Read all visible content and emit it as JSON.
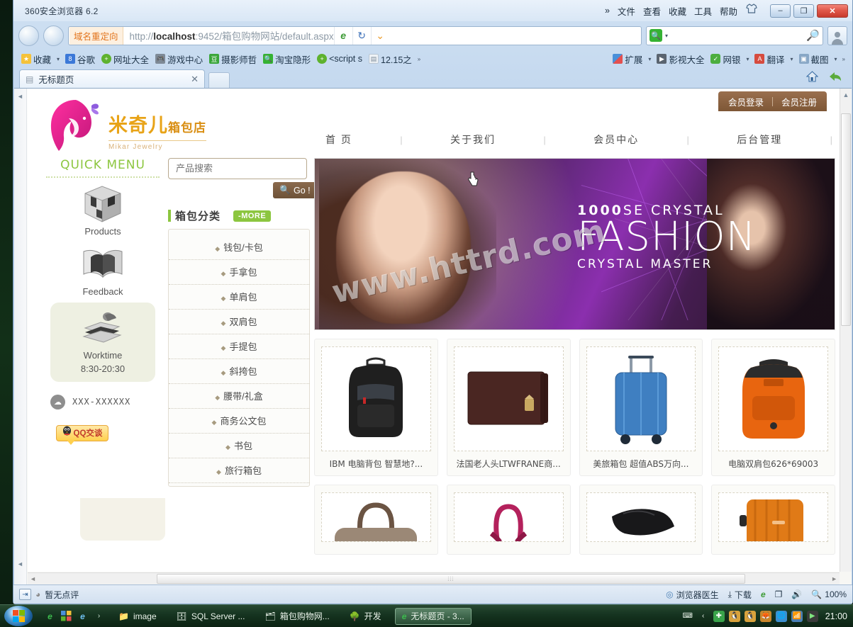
{
  "browser": {
    "window_title": "360安全浏览器 6.2",
    "menu": [
      "文件",
      "查看",
      "收藏",
      "工具",
      "帮助"
    ],
    "overflow_icon": "chevron-double-right-icon",
    "skin_icon": "shirt-icon",
    "window_buttons": {
      "minimize": "–",
      "maximize": "❐",
      "close": "✕"
    },
    "address": {
      "redirect_badge": "域名重定向",
      "url_prefix": "http://",
      "url_host": "localhost",
      "url_rest": ":9452/箱包购物网站/default.aspx",
      "icons": [
        "ie-engine-icon",
        "sync-icon",
        "chevron-down-icon"
      ]
    },
    "search": {
      "placeholder": "",
      "engine_icon": "search-icon",
      "go_icon": "magnifier-icon"
    },
    "account_icon": "user-avatar-icon",
    "bookmarks": [
      {
        "label": "收藏",
        "icon": "star-folder-icon",
        "caret": true
      },
      {
        "label": "谷歌",
        "icon": "google-icon",
        "caret": false
      },
      {
        "label": "网址大全",
        "icon": "plus-circle-icon",
        "caret": false
      },
      {
        "label": "游戏中心",
        "icon": "gamepad-icon",
        "caret": false
      },
      {
        "label": "摄影师哲",
        "icon": "douban-icon",
        "caret": false
      },
      {
        "label": "淘宝隐形",
        "icon": "search-square-icon",
        "caret": false
      },
      {
        "label": "<script s",
        "icon": "plus-circle-icon",
        "caret": false
      },
      {
        "label": "12.15之",
        "icon": "page-icon",
        "caret": false
      },
      {
        "label": "»",
        "icon": "chevron-double-right-icon",
        "caret": false
      }
    ],
    "toolbar_right": [
      {
        "label": "扩展",
        "icon": "extensions-icon",
        "caret": true
      },
      {
        "label": "影视大全",
        "icon": "video-icon",
        "caret": false
      },
      {
        "label": "网银",
        "icon": "shield-icon",
        "caret": true
      },
      {
        "label": "翻译",
        "icon": "translate-icon",
        "caret": true
      },
      {
        "label": "截图",
        "icon": "screenshot-icon",
        "caret": true
      },
      {
        "label": "»",
        "icon": "chevron-double-right-icon",
        "caret": false
      }
    ],
    "tab": {
      "label": "无标题页",
      "favicon": "page-icon",
      "close": "✕"
    },
    "tab_right_icons": [
      "home-icon",
      "back-arrow-icon"
    ]
  },
  "statusbar": {
    "expand_icon": "panel-toggle-icon",
    "rating_text": "暂无点评",
    "items": [
      {
        "label": "浏览器医生",
        "icon": "doctor-icon"
      },
      {
        "label": "下载",
        "icon": "download-icon"
      },
      {
        "label": "",
        "icon": "ie-engine-icon"
      },
      {
        "label": "",
        "icon": "windows-stack-icon"
      },
      {
        "label": "",
        "icon": "speaker-icon"
      },
      {
        "label": "100%",
        "icon": "magnifier-icon"
      }
    ]
  },
  "taskbar": {
    "start_icon": "windows-start-icon",
    "quick_launch": [
      "360-browser-icon",
      "apps-icon",
      "ie-icon",
      "chevron-right-icon"
    ],
    "items": [
      {
        "label": "image",
        "icon": "folder-icon",
        "active": false
      },
      {
        "label": "SQL Server ...",
        "icon": "sql-server-icon",
        "active": false
      },
      {
        "label": "箱包购物网...",
        "icon": "vs-project-icon",
        "active": false
      },
      {
        "label": "开发",
        "icon": "tree-icon",
        "active": false
      },
      {
        "label": "无标题页 - 3...",
        "icon": "ie-engine-icon",
        "active": true
      }
    ],
    "tray_icons": [
      "keyboard-icon",
      "chevron-left-icon",
      "antivirus-icon",
      "qq-icon",
      "qq-icon-2",
      "fox-icon",
      "globe-icon",
      "network-icon",
      "media-icon"
    ],
    "clock": "21:00"
  },
  "site": {
    "logo": {
      "title_cn": "米奇儿",
      "title_suffix": "箱包店",
      "subtitle_en": "Mikar Jewelry"
    },
    "auth": {
      "login": "会员登录",
      "register": "会员注册"
    },
    "nav": [
      "首 页",
      "关于我们",
      "会员中心",
      "后台管理"
    ],
    "quickmenu": {
      "title": "QUICK MENU",
      "items": [
        {
          "label": "Products",
          "icon": "cube-icon"
        },
        {
          "label": "Feedback",
          "icon": "open-book-icon"
        }
      ],
      "worktime": {
        "label": "Worktime",
        "hours": "8:30-20:30",
        "icon": "books-icon"
      },
      "phone": "XXX-XXXXXX",
      "phone_icon": "phone-circle-icon",
      "qq": {
        "label": "QQ交谈",
        "icon": "qq-penguin-icon"
      }
    },
    "search": {
      "placeholder": "产品搜索",
      "value": "",
      "button": "Go !",
      "button_icon": "search-icon"
    },
    "categories": {
      "title": "箱包分类",
      "more": "MORE",
      "items": [
        "钱包/卡包",
        "手拿包",
        "单肩包",
        "双肩包",
        "手提包",
        "斜挎包",
        "腰带/礼盒",
        "商务公文包",
        "书包",
        "旅行箱包"
      ]
    },
    "banner": {
      "line1_strong": "1000",
      "line1_rest": "SE  CRYSTAL",
      "line2": "FASHION",
      "line3": "CRYSTAL MASTER",
      "watermark": "www.httrd.com"
    },
    "products_row1": [
      {
        "name": "IBM 电脑背包 智慧地?...",
        "thumb": "black-backpack"
      },
      {
        "name": "法国老人头LTWFRANE商...",
        "thumb": "brown-wallet"
      },
      {
        "name": "美旅箱包 超值ABS万向...",
        "thumb": "blue-suitcase"
      },
      {
        "name": "电脑双肩包626*69003",
        "thumb": "orange-backpack"
      }
    ],
    "products_row2": [
      {
        "name": "",
        "thumb": "brown-duffel"
      },
      {
        "name": "",
        "thumb": "pink-handbag"
      },
      {
        "name": "",
        "thumb": "black-laptop-bag"
      },
      {
        "name": "",
        "thumb": "orange-hardcase"
      }
    ]
  },
  "colors": {
    "brand_pink": "#e0218a",
    "brand_gold": "#e8a317",
    "accent_green": "#8cc63f",
    "auth_brown": "#7e5736",
    "go_brown": "#6e5238"
  }
}
